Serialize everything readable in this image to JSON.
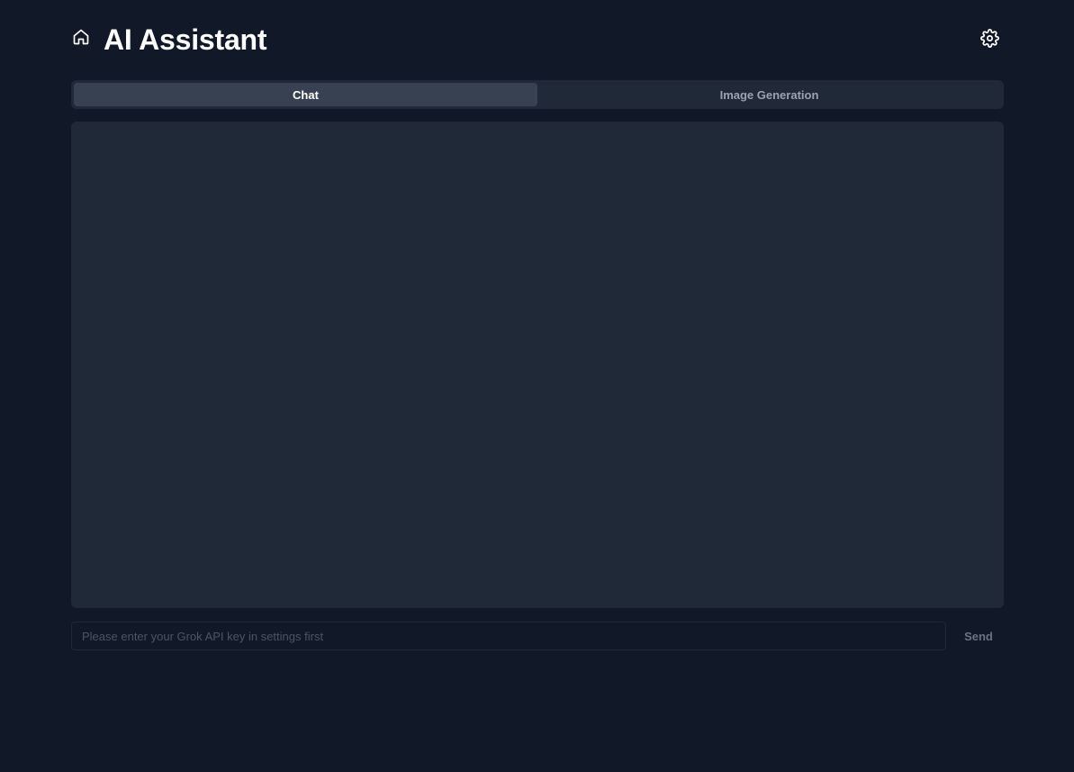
{
  "header": {
    "title": "AI Assistant",
    "home_icon": "home-icon",
    "settings_icon": "gear-icon"
  },
  "tabs": [
    {
      "label": "Chat",
      "active": true
    },
    {
      "label": "Image Generation",
      "active": false
    }
  ],
  "chat": {
    "messages": []
  },
  "composer": {
    "placeholder": "Please enter your Grok API key in settings first",
    "value": "",
    "send_label": "Send"
  },
  "colors": {
    "background": "#111827",
    "panel": "#1f2937",
    "active_tab": "#374151",
    "muted_text": "#9ca3af"
  }
}
